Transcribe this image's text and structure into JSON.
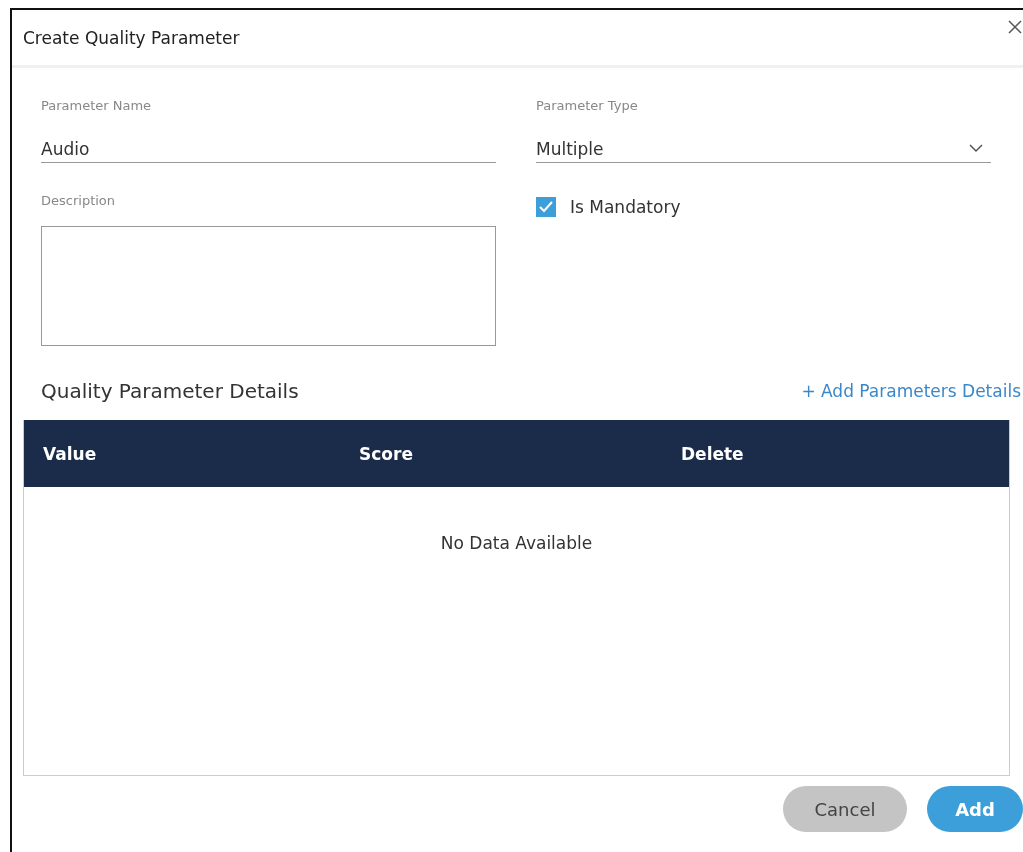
{
  "dialog": {
    "title": "Create Quality Parameter"
  },
  "fields": {
    "parameter_name": {
      "label": "Parameter Name",
      "value": "Audio"
    },
    "parameter_type": {
      "label": "Parameter Type",
      "value": "Multiple"
    },
    "description": {
      "label": "Description"
    },
    "is_mandatory": {
      "label": "Is Mandatory",
      "checked": true
    }
  },
  "details": {
    "title": "Quality Parameter Details",
    "add_link": "+ Add Parameters Details",
    "table": {
      "columns": [
        "Value",
        "Score",
        "Delete"
      ],
      "empty_message": "No Data Available"
    }
  },
  "buttons": [
    {
      "label": "Cancel",
      "kind": "secondary"
    },
    {
      "label": "Add",
      "kind": "primary"
    }
  ]
}
